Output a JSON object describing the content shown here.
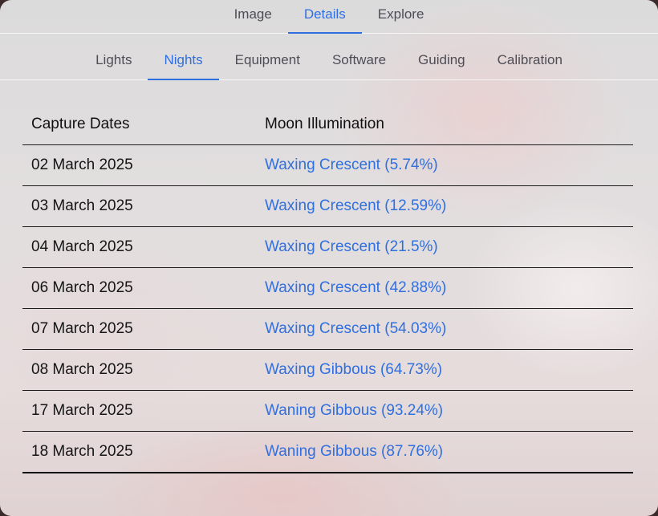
{
  "primary_tabs": [
    {
      "label": "Image",
      "active": false
    },
    {
      "label": "Details",
      "active": true
    },
    {
      "label": "Explore",
      "active": false
    }
  ],
  "secondary_tabs": [
    {
      "label": "Lights",
      "active": false
    },
    {
      "label": "Nights",
      "active": true
    },
    {
      "label": "Equipment",
      "active": false
    },
    {
      "label": "Software",
      "active": false
    },
    {
      "label": "Guiding",
      "active": false
    },
    {
      "label": "Calibration",
      "active": false
    }
  ],
  "table": {
    "headers": {
      "date": "Capture Dates",
      "moon": "Moon Illumination"
    },
    "rows": [
      {
        "date": "02 March 2025",
        "moon": "Waxing Crescent (5.74%)"
      },
      {
        "date": "03 March 2025",
        "moon": "Waxing Crescent (12.59%)"
      },
      {
        "date": "04 March 2025",
        "moon": "Waxing Crescent (21.5%)"
      },
      {
        "date": "06 March 2025",
        "moon": "Waxing Crescent (42.88%)"
      },
      {
        "date": "07 March 2025",
        "moon": "Waxing Crescent (54.03%)"
      },
      {
        "date": "08 March 2025",
        "moon": "Waxing Gibbous (64.73%)"
      },
      {
        "date": "17 March 2025",
        "moon": "Waning Gibbous (93.24%)"
      },
      {
        "date": "18 March 2025",
        "moon": "Waning Gibbous (87.76%)"
      }
    ]
  },
  "colors": {
    "accent": "#2f6fe0",
    "text": "#151515",
    "tab_text": "#4d4d55"
  }
}
